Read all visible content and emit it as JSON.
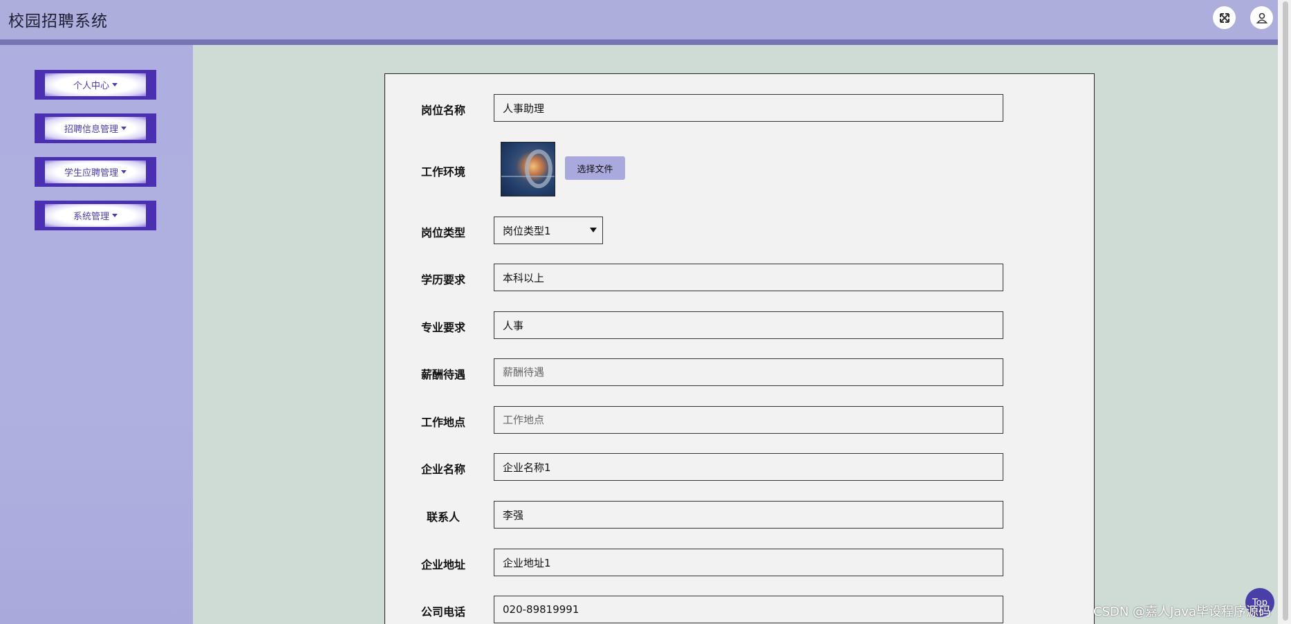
{
  "header": {
    "title": "校园招聘系统",
    "icons": [
      "fullscreen-icon",
      "user-icon"
    ]
  },
  "sidebar": {
    "items": [
      {
        "label": "个人中心"
      },
      {
        "label": "招聘信息管理"
      },
      {
        "label": "学生应聘管理"
      },
      {
        "label": "系统管理"
      }
    ]
  },
  "form": {
    "job_name": {
      "label": "岗位名称",
      "value": "人事助理",
      "placeholder": ""
    },
    "work_env": {
      "label": "工作环境",
      "file_button": "选择文件"
    },
    "job_type": {
      "label": "岗位类型",
      "selected": "岗位类型1"
    },
    "education": {
      "label": "学历要求",
      "value": "本科以上",
      "placeholder": ""
    },
    "major": {
      "label": "专业要求",
      "value": "人事",
      "placeholder": ""
    },
    "salary": {
      "label": "薪酬待遇",
      "value": "",
      "placeholder": "薪酬待遇"
    },
    "location": {
      "label": "工作地点",
      "value": "",
      "placeholder": "工作地点"
    },
    "company_name": {
      "label": "企业名称",
      "value": "企业名称1",
      "placeholder": ""
    },
    "contact": {
      "label": "联系人",
      "value": "李强",
      "placeholder": ""
    },
    "company_address": {
      "label": "企业地址",
      "value": "企业地址1",
      "placeholder": ""
    },
    "company_phone": {
      "label": "公司电话",
      "value": "020-89819991",
      "placeholder": ""
    }
  },
  "footer": {
    "watermark": "CSDN @嘉人Java毕设程序源码",
    "top_label": "Top"
  },
  "colors": {
    "header_bg": "#aeaedd",
    "header_bar": "#7575b5",
    "sidebar_bg": "#aeaee0",
    "menu_accent": "#4a2fb0",
    "content_bg": "#cfdcd6",
    "file_button_bg": "#a9a9dd"
  }
}
